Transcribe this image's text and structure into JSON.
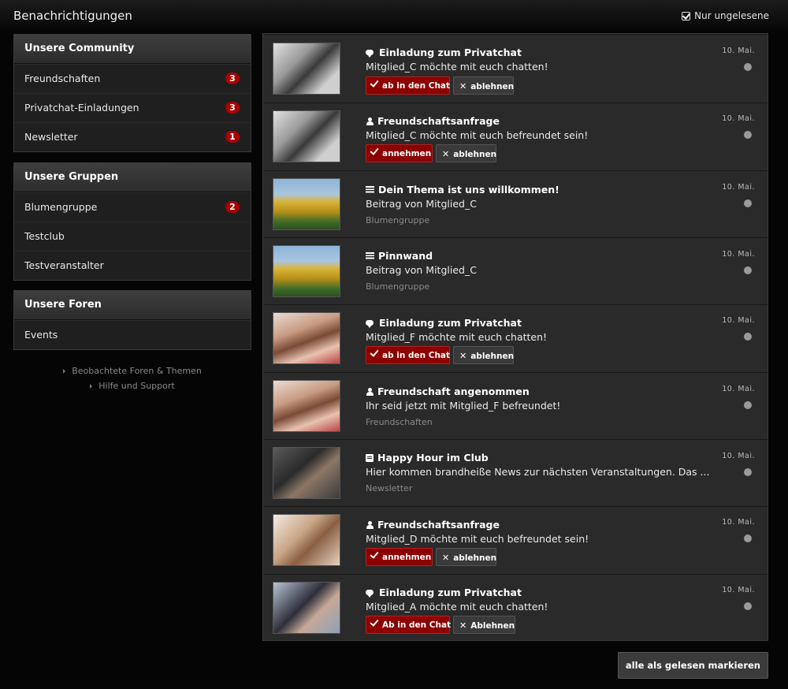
{
  "header": {
    "title": "Benachrichtigungen",
    "filter_label": "Nur ungelesene"
  },
  "sidebar": {
    "community": {
      "title": "Unsere Community",
      "items": [
        {
          "label": "Freundschaften",
          "badge": "3"
        },
        {
          "label": "Privatchat-Einladungen",
          "badge": "3"
        },
        {
          "label": "Newsletter",
          "badge": "1"
        }
      ]
    },
    "groups": {
      "title": "Unsere Gruppen",
      "items": [
        {
          "label": "Blumengruppe",
          "badge": "2"
        },
        {
          "label": "Testclub"
        },
        {
          "label": "Testveranstalter"
        }
      ]
    },
    "forums": {
      "title": "Unsere Foren",
      "items": [
        {
          "label": "Events"
        }
      ]
    },
    "links": [
      "Beobachtete Foren & Themen",
      "Hilfe und Support"
    ]
  },
  "notifications": [
    {
      "icon": "chat-icon",
      "title": "Einladung zum Privatchat",
      "text": "Mitglied_C möchte mit euch chatten!",
      "date": "10. Mai.",
      "primary": "ab in den Chat",
      "secondary": "ablehnen"
    },
    {
      "icon": "user-icon",
      "title": "Freundschaftsanfrage",
      "text": "Mitglied_C möchte mit euch befreundet sein!",
      "date": "10. Mai.",
      "primary": "annehmen",
      "secondary": "ablehnen"
    },
    {
      "icon": "post-icon",
      "title": "Dein Thema ist uns willkommen!",
      "text": "Beitrag von Mitglied_C",
      "sub": "Blumengruppe",
      "date": "10. Mai."
    },
    {
      "icon": "post-icon",
      "title": "Pinnwand",
      "text": "Beitrag von Mitglied_C",
      "sub": "Blumengruppe",
      "date": "10. Mai."
    },
    {
      "icon": "chat-icon",
      "title": "Einladung zum Privatchat",
      "text": "Mitglied_F möchte mit euch chatten!",
      "date": "10. Mai.",
      "primary": "ab in den Chat",
      "secondary": "ablehnen"
    },
    {
      "icon": "user-icon",
      "title": "Freundschaft angenommen",
      "text": "Ihr seid jetzt mit Mitglied_F befreundet!",
      "sub": "Freundschaften",
      "date": "10. Mai."
    },
    {
      "icon": "newsletter-icon",
      "title": "Happy Hour im Club",
      "text": "Hier kommen brandheiße News zur nächsten Veranstaltungen. Das ...",
      "sub": "Newsletter",
      "date": "10. Mai."
    },
    {
      "icon": "user-icon",
      "title": "Freundschaftsanfrage",
      "text": "Mitglied_D möchte mit euch befreundet sein!",
      "date": "10. Mai.",
      "primary": "annehmen",
      "secondary": "ablehnen"
    },
    {
      "icon": "chat-icon",
      "title": "Einladung zum Privatchat",
      "text": "Mitglied_A möchte mit euch chatten!",
      "date": "10. Mai.",
      "primary": "Ab in den Chat",
      "secondary": "Ablehnen"
    }
  ],
  "footer": {
    "mark_all_label": "alle als gelesen markieren"
  }
}
